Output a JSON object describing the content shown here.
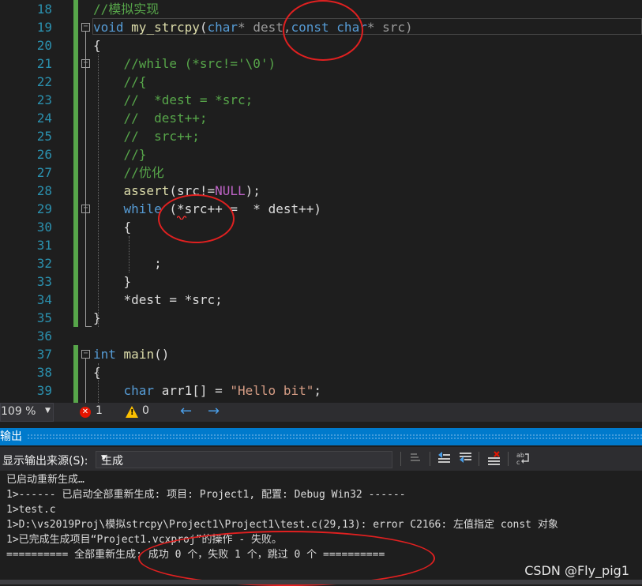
{
  "editor": {
    "line_numbers": [
      "18",
      "19",
      "20",
      "21",
      "22",
      "23",
      "24",
      "25",
      "26",
      "27",
      "28",
      "29",
      "30",
      "31",
      "32",
      "33",
      "34",
      "35",
      "36",
      "37",
      "38",
      "39"
    ],
    "code": {
      "l18": "//模拟实现",
      "l19_void": "void",
      "l19_fn": "my_strcpy",
      "l19_open": "(",
      "l19_char1": "char",
      "l19_dest": "* dest,",
      "l19_const": "const",
      "l19_char2": "char",
      "l19_src": "* src)",
      "l20": "{",
      "l21": "//while (*src!='\\0')",
      "l22": "//{",
      "l23": "//  *dest = *src;",
      "l24": "//  dest++;",
      "l25": "//  src++;",
      "l26": "//}",
      "l27": "//优化",
      "l28_fn": "assert",
      "l28_a": "(src!=",
      "l28_null": "NULL",
      "l28_b": ");",
      "l29_kw": "while",
      "l29_rest": " (*src++ =  * dest++)",
      "l30": "{",
      "l32": ";",
      "l33": "}",
      "l34": "*dest = *src;",
      "l35": "}",
      "l37_kw": "int",
      "l37_fn": "main",
      "l37_rest": "()",
      "l38": "{",
      "l39_kw": "char",
      "l39_var": " arr1[] = ",
      "l39_str": "\"Hello bit\"",
      "l39_end": ";"
    }
  },
  "status": {
    "zoom": "109 %",
    "error_count": "1",
    "warning_count": "0",
    "error_glyph": "✕",
    "warning_glyph": "!",
    "back_glyph": "←",
    "forward_glyph": "→"
  },
  "output": {
    "title": "输出",
    "source_label": "显示输出来源(S):",
    "source_value": "生成",
    "lines": [
      "已启动重新生成…",
      "1>------ 已启动全部重新生成: 项目: Project1, 配置: Debug Win32 ------",
      "1>test.c",
      "1>D:\\vs2019Proj\\模拟strcpy\\Project1\\Project1\\test.c(29,13): error C2166: 左值指定 const 对象",
      "1>已完成生成项目“Project1.vcxproj”的操作 - 失败。",
      "========== 全部重新生成: 成功 0 个，失败 1 个，跳过 0 个 =========="
    ]
  },
  "watermark": "CSDN @Fly_pig1",
  "colors": {
    "comment": "#57a64a",
    "keyword": "#569cd6",
    "function": "#dcdcaa",
    "macro": "#bd63c5",
    "string": "#d69d85",
    "accent": "#007acc",
    "annotation": "#e02020"
  }
}
